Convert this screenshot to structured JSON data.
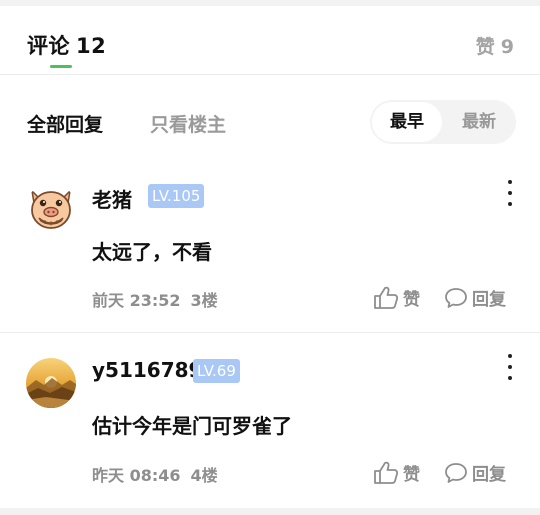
{
  "tabs": {
    "comments_label": "评论",
    "comments_count": "12",
    "likes_label": "赞",
    "likes_count": "9"
  },
  "filters": {
    "all_replies": "全部回复",
    "only_op": "只看楼主"
  },
  "sort": {
    "earliest": "最早",
    "latest": "最新",
    "selected": "最早"
  },
  "comments": [
    {
      "username": "老猪",
      "level": "LV.105",
      "content": "太远了，不看",
      "time": "前天 23:52",
      "floor": "3楼",
      "like_label": "赞",
      "reply_label": "回复",
      "avatar_icon": "pig-face-icon"
    },
    {
      "username": "y51167899",
      "level": "LV.69",
      "content": "估计今年是门可罗雀了",
      "time": "昨天 08:46",
      "floor": "4楼",
      "like_label": "赞",
      "reply_label": "回复",
      "avatar_icon": "sunset-landscape-avatar"
    }
  ],
  "colors": {
    "accent_green": "#4cc25a",
    "level_badge": "#a9c8f5",
    "muted_text": "#8e8e8e"
  }
}
